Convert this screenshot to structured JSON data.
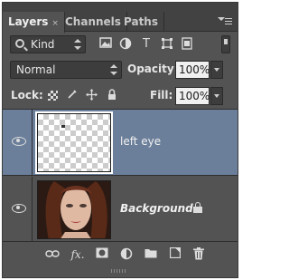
{
  "tabs": [
    {
      "label": "Layers",
      "close": "×"
    },
    {
      "label": "Channels"
    },
    {
      "label": "Paths"
    }
  ],
  "filter": {
    "kind_label": "Kind",
    "icons": [
      "image-filter-icon",
      "adjustment-filter-icon",
      "type-filter-icon",
      "shape-filter-icon",
      "smart-object-filter-icon"
    ],
    "glyph_T": "T"
  },
  "blend": {
    "mode": "Normal",
    "opacity_label": "Opacity:",
    "opacity_value": "100%",
    "lock_label": "Lock:",
    "fill_label": "Fill:",
    "fill_value": "100%"
  },
  "layers": [
    {
      "name": "left eye",
      "selected": true,
      "visible": true,
      "locked": false
    },
    {
      "name": "Background",
      "selected": false,
      "visible": true,
      "locked": true
    }
  ],
  "bottom_toolbar": [
    "link-layers-icon",
    "fx-icon",
    "add-mask-icon",
    "adjustment-layer-icon",
    "new-group-icon",
    "new-layer-icon",
    "delete-layer-icon"
  ],
  "bottom_fx_label": "fx.",
  "colors": {
    "panel": "#535353",
    "selected_row": "#6b7f9a"
  }
}
